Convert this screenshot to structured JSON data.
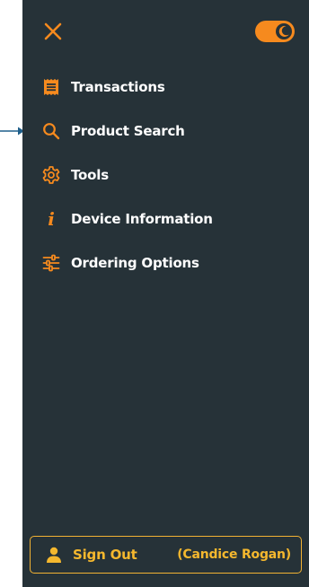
{
  "colors": {
    "drawer_bg": "#263238",
    "accent": "#f68a1e",
    "signout_accent": "#f5b82e",
    "pointer": "#1f5f8b",
    "text": "#ffffff"
  },
  "header": {
    "close_icon": "close-icon",
    "theme_toggle": {
      "icon": "moon-icon",
      "state": "dark-mode-on"
    }
  },
  "menu": {
    "items": [
      {
        "label": "Transactions",
        "icon": "receipt-icon"
      },
      {
        "label": "Product Search",
        "icon": "search-icon"
      },
      {
        "label": "Tools",
        "icon": "gear-icon"
      },
      {
        "label": "Device Information",
        "icon": "info-icon",
        "glyph": "i"
      },
      {
        "label": "Ordering Options",
        "icon": "sliders-icon"
      }
    ]
  },
  "footer": {
    "signout_label": "Sign Out",
    "user_name": "(Candice Rogan)",
    "icon": "person-icon"
  }
}
